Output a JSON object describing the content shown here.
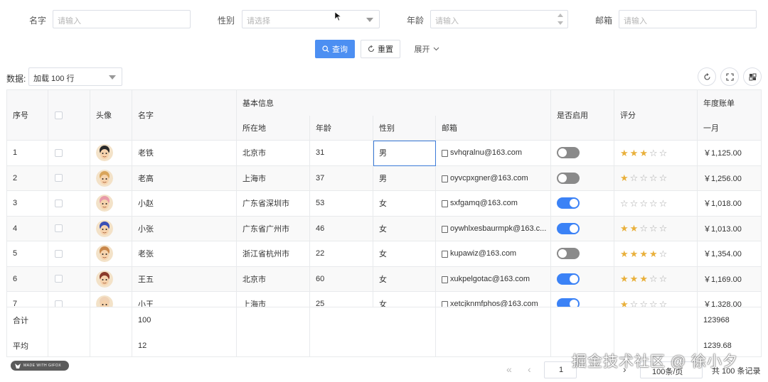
{
  "search_form": {
    "name": {
      "label": "名字",
      "placeholder": "请输入"
    },
    "gender": {
      "label": "性别",
      "placeholder": "请选择"
    },
    "age": {
      "label": "年龄",
      "placeholder": "请输入"
    },
    "email": {
      "label": "邮箱",
      "placeholder": "请输入"
    },
    "query_label": "查询",
    "reset_label": "重置",
    "expand_label": "展开"
  },
  "toolbar": {
    "data_label": "数据:",
    "load_select": "加载 100 行"
  },
  "table": {
    "headers": {
      "index": "序号",
      "avatar": "头像",
      "name": "名字",
      "basic_info": "基本信息",
      "location": "所在地",
      "age": "年龄",
      "gender": "性别",
      "email": "邮箱",
      "enabled": "是否启用",
      "rating": "评分",
      "annual_bill": "年度账单",
      "month1": "一月"
    },
    "rows": [
      {
        "index": "1",
        "name": "老铁",
        "location": "北京市",
        "age": "31",
        "gender": "男",
        "email": "svhqralnu@163.com",
        "enabled": false,
        "rating": 3,
        "month1": "￥1,125.00",
        "avatar_color": "#2b2b2b"
      },
      {
        "index": "2",
        "name": "老高",
        "location": "上海市",
        "age": "37",
        "gender": "男",
        "email": "oyvcpxgner@163.com",
        "enabled": false,
        "rating": 1,
        "month1": "￥1,256.00",
        "avatar_color": "#d9a55b"
      },
      {
        "index": "3",
        "name": "小赵",
        "location": "广东省深圳市",
        "age": "53",
        "gender": "女",
        "email": "sxfgamq@163.com",
        "enabled": true,
        "rating": 0,
        "month1": "￥1,018.00",
        "avatar_color": "#e89aa8"
      },
      {
        "index": "4",
        "name": "小张",
        "location": "广东省广州市",
        "age": "46",
        "gender": "女",
        "email": "oywhlxesbaurmpk@163.c...",
        "enabled": true,
        "rating": 2,
        "month1": "￥1,013.00",
        "avatar_color": "#3a4fb5"
      },
      {
        "index": "5",
        "name": "老张",
        "location": "浙江省杭州市",
        "age": "22",
        "gender": "女",
        "email": "kupawiz@163.com",
        "enabled": false,
        "rating": 4,
        "month1": "￥1,354.00",
        "avatar_color": "#c9874a"
      },
      {
        "index": "6",
        "name": "王五",
        "location": "北京市",
        "age": "60",
        "gender": "女",
        "email": "xukpelgotac@163.com",
        "enabled": true,
        "rating": 3,
        "month1": "￥1,169.00",
        "avatar_color": "#8a3a2a"
      },
      {
        "index": "7",
        "name": "小王",
        "location": "上海市",
        "age": "25",
        "gender": "女",
        "email": "xetcjknmfphos@163.com",
        "enabled": true,
        "rating": 1,
        "month1": "￥1,328.00",
        "avatar_color": "#f0d2b5"
      }
    ],
    "footer": {
      "sum_label": "合计",
      "sum_name": "100",
      "sum_bill": "123968",
      "avg_label": "平均",
      "avg_name": "12",
      "avg_bill": "1239.68"
    }
  },
  "pagination": {
    "current_page": "1",
    "page_size": "100条/页",
    "total": "共 100 条记录"
  },
  "watermark": "掘金技术社区 @ 徐小夕",
  "badge": "MADE WITH GIFOX",
  "colors": {
    "primary": "#4c8ff2",
    "switch_on": "#3b82f6",
    "switch_off": "#8a8a8a",
    "star": "#e9b03b"
  }
}
